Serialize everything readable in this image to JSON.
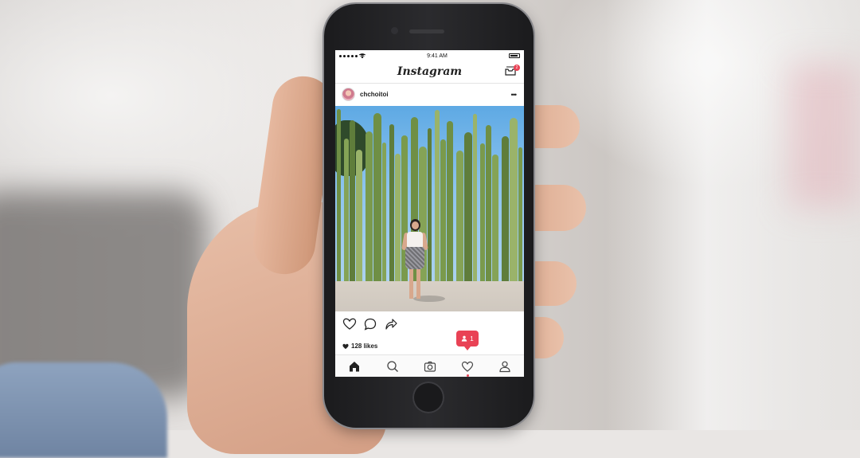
{
  "status_bar": {
    "time": "9:41 AM"
  },
  "app": {
    "title": "Instagram"
  },
  "header": {
    "inbox_badge": "2"
  },
  "post": {
    "username": "chchoitoi",
    "likes": "128 likes"
  },
  "notification": {
    "count": "1"
  },
  "tabs": [
    "home",
    "search",
    "camera",
    "activity",
    "profile"
  ],
  "colors": {
    "accent": "#e94255",
    "text": "#222222"
  }
}
